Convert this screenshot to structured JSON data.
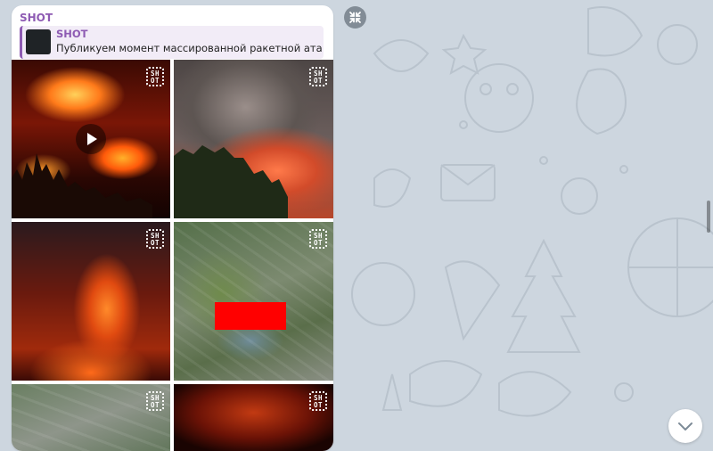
{
  "wallpaper": {
    "pattern": "telegram-doodles",
    "color": "#cdd6df"
  },
  "message": {
    "sender": "SHOT",
    "sender_color": "#8e5bb3",
    "reply": {
      "title": "SHOT",
      "text": "Публикуем момент массированной ракетной атаки по ..."
    },
    "album": [
      {
        "type": "video",
        "watermark": "SHOT",
        "icon": "play-icon"
      },
      {
        "type": "photo",
        "watermark": "SHOT"
      },
      {
        "type": "photo",
        "watermark": "SHOT"
      },
      {
        "type": "photo",
        "watermark": "SHOT",
        "redaction_color": "#ff0000"
      },
      {
        "type": "photo",
        "watermark": "SHOT"
      },
      {
        "type": "photo",
        "watermark": "SHOT"
      }
    ]
  },
  "controls": {
    "collapse_icon": "collapse-arrows-icon",
    "scroll_down_icon": "chevron-down-icon"
  }
}
